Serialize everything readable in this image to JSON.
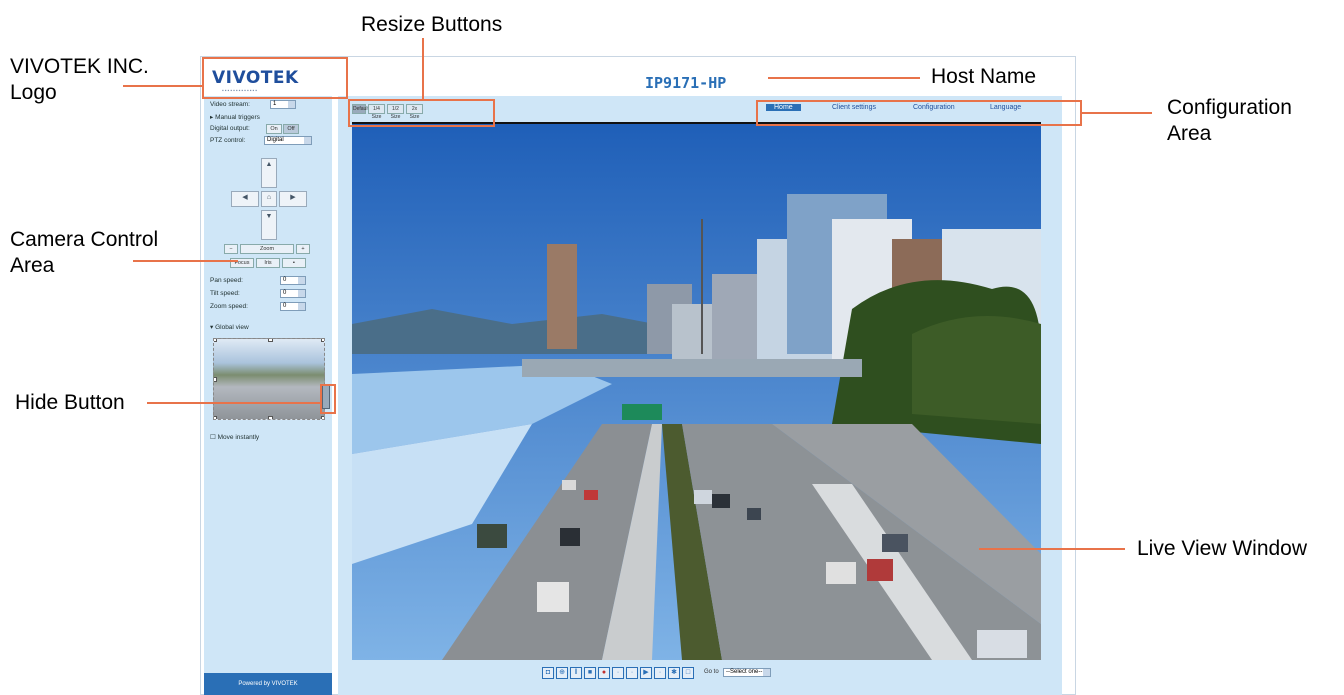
{
  "annotations": {
    "logo": "VIVOTEK INC.\n Logo",
    "resize_buttons": "Resize Buttons",
    "host_name": "Host Name",
    "configuration_area": "Configuration\nArea",
    "camera_control_area": "Camera Control\nArea",
    "hide_button": "Hide Button",
    "live_view_window": "Live View Window"
  },
  "app": {
    "logo_text": "VIVOTEK",
    "host_name": "IP9171-HP",
    "resize_buttons": [
      "Default",
      "1/4 Size",
      "1/2 Size",
      "2x Size"
    ],
    "config_nav": {
      "home": "Home",
      "client_settings": "Client settings",
      "configuration": "Configuration",
      "language": "Language"
    },
    "sidebar": {
      "video_stream_label": "Video stream:",
      "video_stream_value": "1",
      "manual_trigger": "Manual triggers",
      "digital_output_label": "Digital output:",
      "digital_output_on": "On",
      "digital_output_off": "Off",
      "ptz_control_label": "PTZ control:",
      "ptz_control_value": "Digital",
      "zoom_label": "Zoom",
      "focus_label": "Focus",
      "iris_label": "Iris",
      "pan_speed_label": "Pan speed:",
      "pan_speed_value": "0",
      "tilt_speed_label": "Tilt speed:",
      "tilt_speed_value": "0",
      "zoom_speed_label": "Zoom speed:",
      "zoom_speed_value": "0",
      "global_view": "Global view",
      "move_instantly": "Move instantly",
      "footer": "Powered by VIVOTEK"
    },
    "toolbar": {
      "goto_label": "Go to",
      "goto_value": "--Select one--"
    },
    "colors": {
      "accent": "#2a6fb6",
      "panel": "#cfe6f7",
      "callout": "#e8734a"
    }
  }
}
